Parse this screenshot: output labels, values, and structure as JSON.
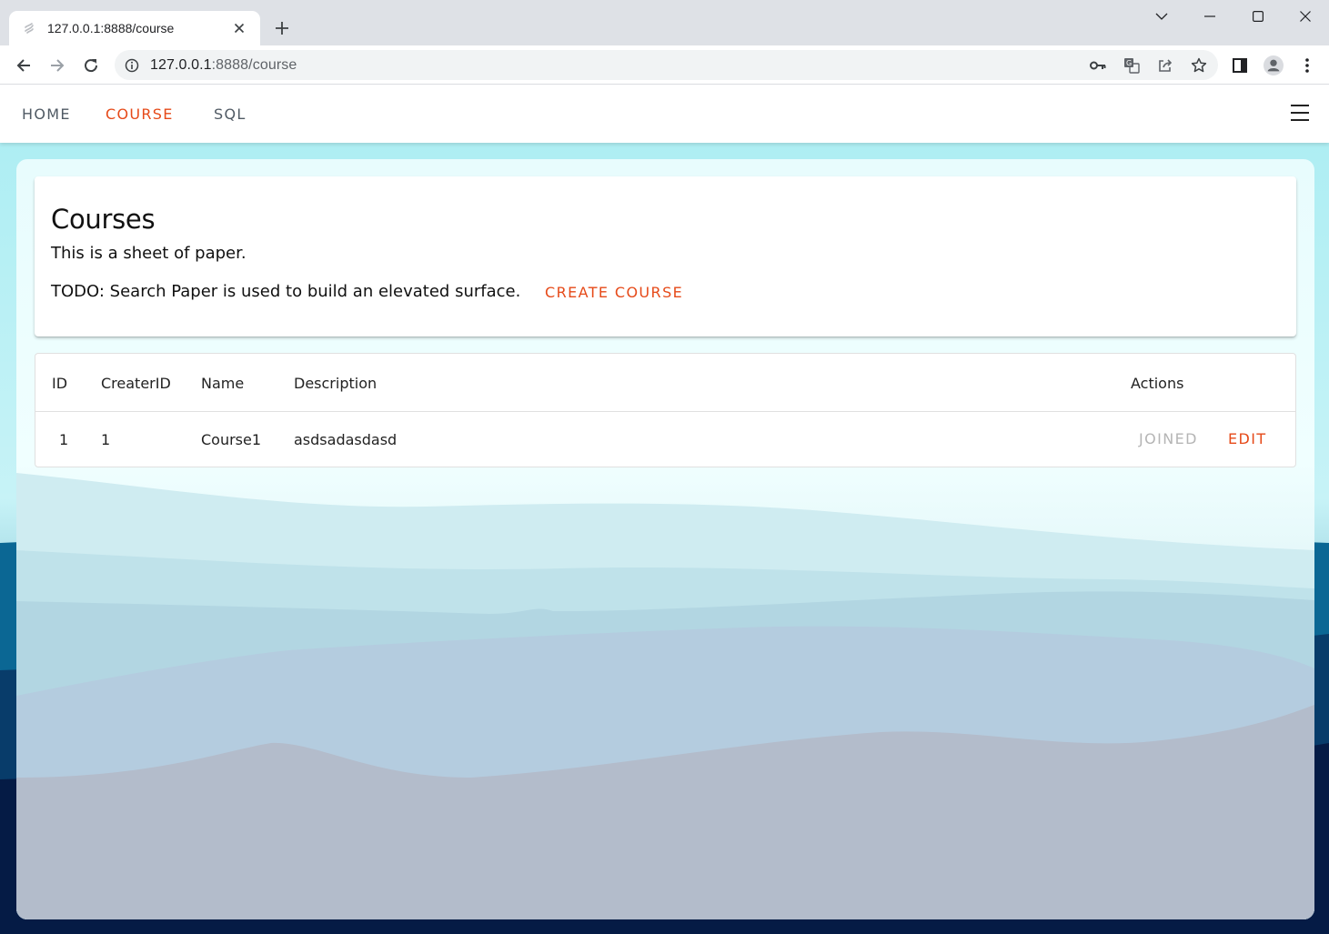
{
  "browser": {
    "tab_title": "127.0.0.1:8888/course",
    "url_host": "127.0.0.1",
    "url_rest": ":8888/course"
  },
  "nav": {
    "items": [
      {
        "label": "HOME",
        "active": false
      },
      {
        "label": "COURSE",
        "active": true
      },
      {
        "label": "SQL",
        "active": false
      }
    ]
  },
  "header_paper": {
    "title": "Courses",
    "line1": "This is a sheet of paper.",
    "line2": "TODO: Search Paper is used to build an elevated surface.",
    "create_label": "CREATE COURSE"
  },
  "table": {
    "headers": [
      "ID",
      "CreaterID",
      "Name",
      "Description",
      "Actions"
    ],
    "rows": [
      {
        "id": "1",
        "creater_id": "1",
        "name": "Course1",
        "description": "asdsadasdasd",
        "joined_label": "JOINED",
        "edit_label": "EDIT"
      }
    ]
  },
  "colors": {
    "accent": "#e64a19",
    "disabled": "#b5b5b5"
  }
}
